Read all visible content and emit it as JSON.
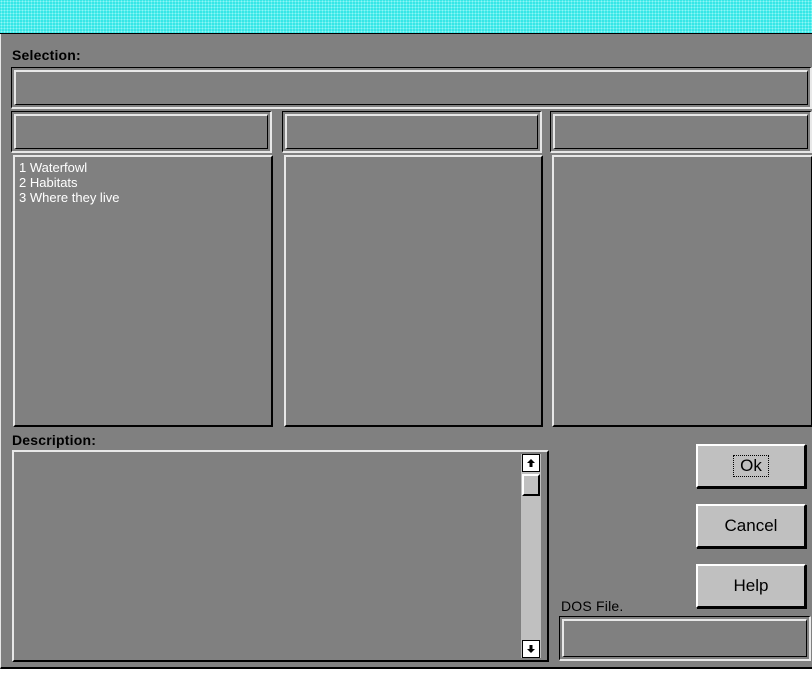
{
  "labels": {
    "selection": "Selection:",
    "description": "Description:",
    "dos_file": "DOS File."
  },
  "lists": {
    "column1": [
      "1 Waterfowl",
      "2 Habitats",
      "3 Where they live"
    ],
    "column2": [],
    "column3": []
  },
  "buttons": {
    "ok": "Ok",
    "cancel": "Cancel",
    "help": "Help"
  },
  "icons": {
    "scroll_up": "scroll-up-arrow-icon",
    "scroll_down": "scroll-down-arrow-icon"
  },
  "colors": {
    "titlebar": "#33e6e6",
    "dialog_bg": "#808080",
    "button_face": "#c0c0c0"
  }
}
